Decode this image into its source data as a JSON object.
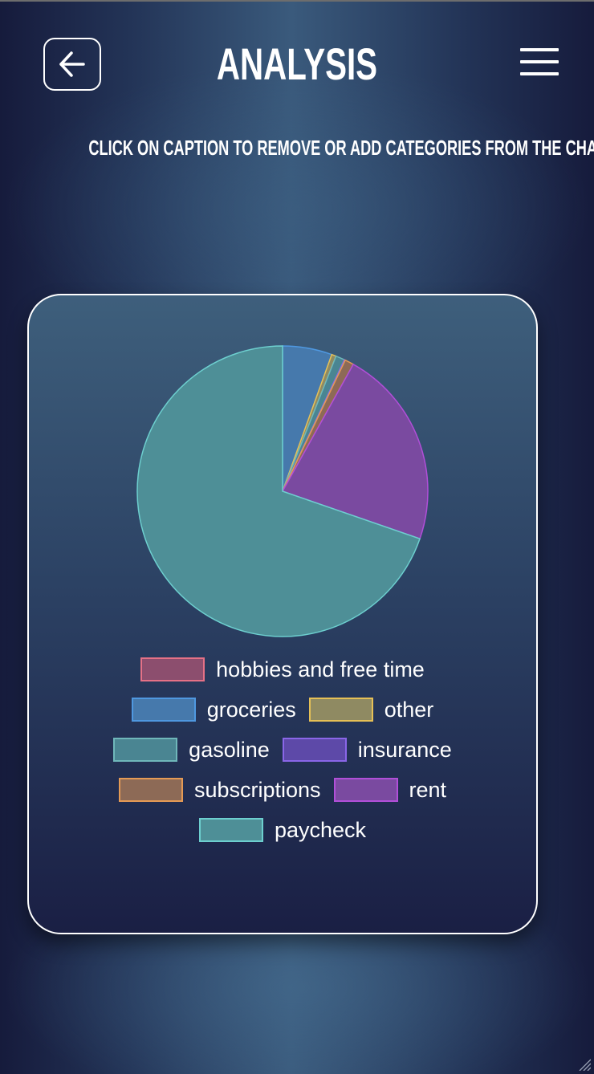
{
  "header": {
    "title": "ANALYSIS"
  },
  "subtitle": "CLICK ON CAPTION TO REMOVE OR ADD CATEGORIES FROM THE CHART",
  "icons": {
    "back": "back-arrow-icon",
    "menu": "hamburger-menu-icon"
  },
  "chart_data": {
    "type": "pie",
    "categories": [
      "hobbies and free time",
      "groceries",
      "other",
      "gasoline",
      "insurance",
      "subscriptions",
      "rent",
      "paycheck"
    ],
    "values": [
      0,
      5.5,
      0.5,
      1.0,
      0.1,
      1.0,
      22.2,
      69.7
    ],
    "colors": {
      "fill": [
        "#8c4e6e",
        "#4679ac",
        "#8f8a62",
        "#4a8592",
        "#5d49a8",
        "#8d6a56",
        "#7a4aa0",
        "#4e8f97"
      ],
      "border": [
        "#e57186",
        "#4f98e0",
        "#e6c056",
        "#6fb7ba",
        "#8a66e8",
        "#e49a55",
        "#b14fd8",
        "#6dcfcf"
      ]
    },
    "legend_position": "bottom"
  }
}
